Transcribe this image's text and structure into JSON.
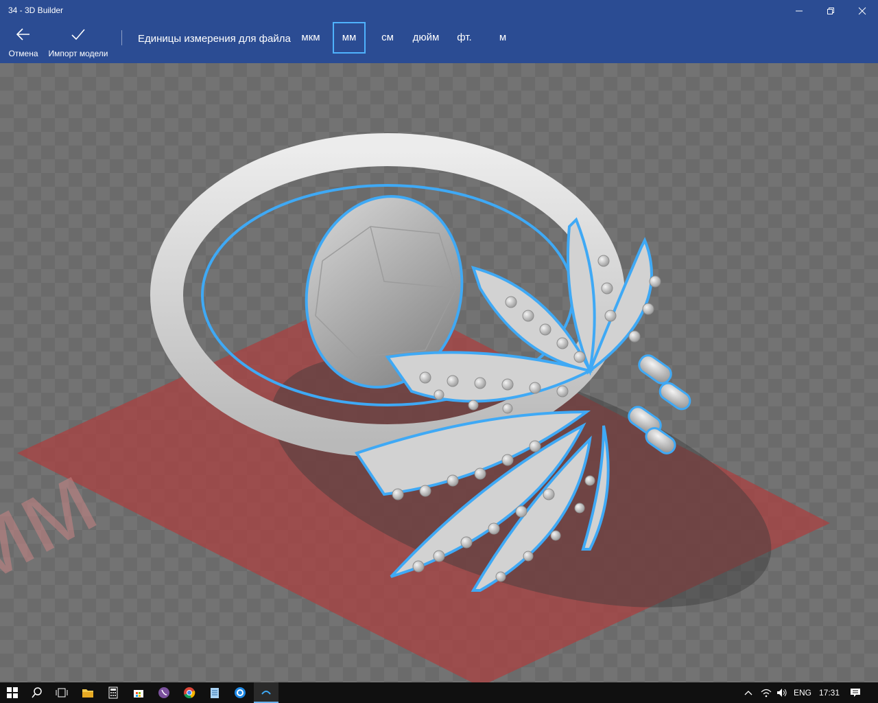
{
  "window": {
    "title": "34 - 3D Builder",
    "minimize_icon": "minimize-icon",
    "restore_icon": "restore-icon",
    "close_icon": "close-icon"
  },
  "commands": {
    "cancel_label": "Отмена",
    "cancel_icon": "arrow-left-icon",
    "import_label": "Импорт модели",
    "import_icon": "checkmark-icon"
  },
  "units": {
    "label": "Единицы измерения для файла",
    "options": [
      "мкм",
      "мм",
      "см",
      "дюйм",
      "фт.",
      "м"
    ],
    "selected": "мм"
  },
  "viewport": {
    "plate_text": "мм",
    "model": "ring"
  },
  "taskbar": {
    "icons": [
      "windows-start-icon",
      "search-icon",
      "task-view-icon",
      "file-explorer-icon",
      "calculator-icon",
      "store-icon",
      "viber-icon",
      "chrome-icon",
      "notepad-icon",
      "browser-icon",
      "3d-builder-icon"
    ],
    "language": "ENG",
    "time": "17:31"
  },
  "colors": {
    "appbar": "#2b4c93",
    "selection": "#4fb3ff",
    "plate": "#a84242",
    "taskbar": "#101010"
  }
}
